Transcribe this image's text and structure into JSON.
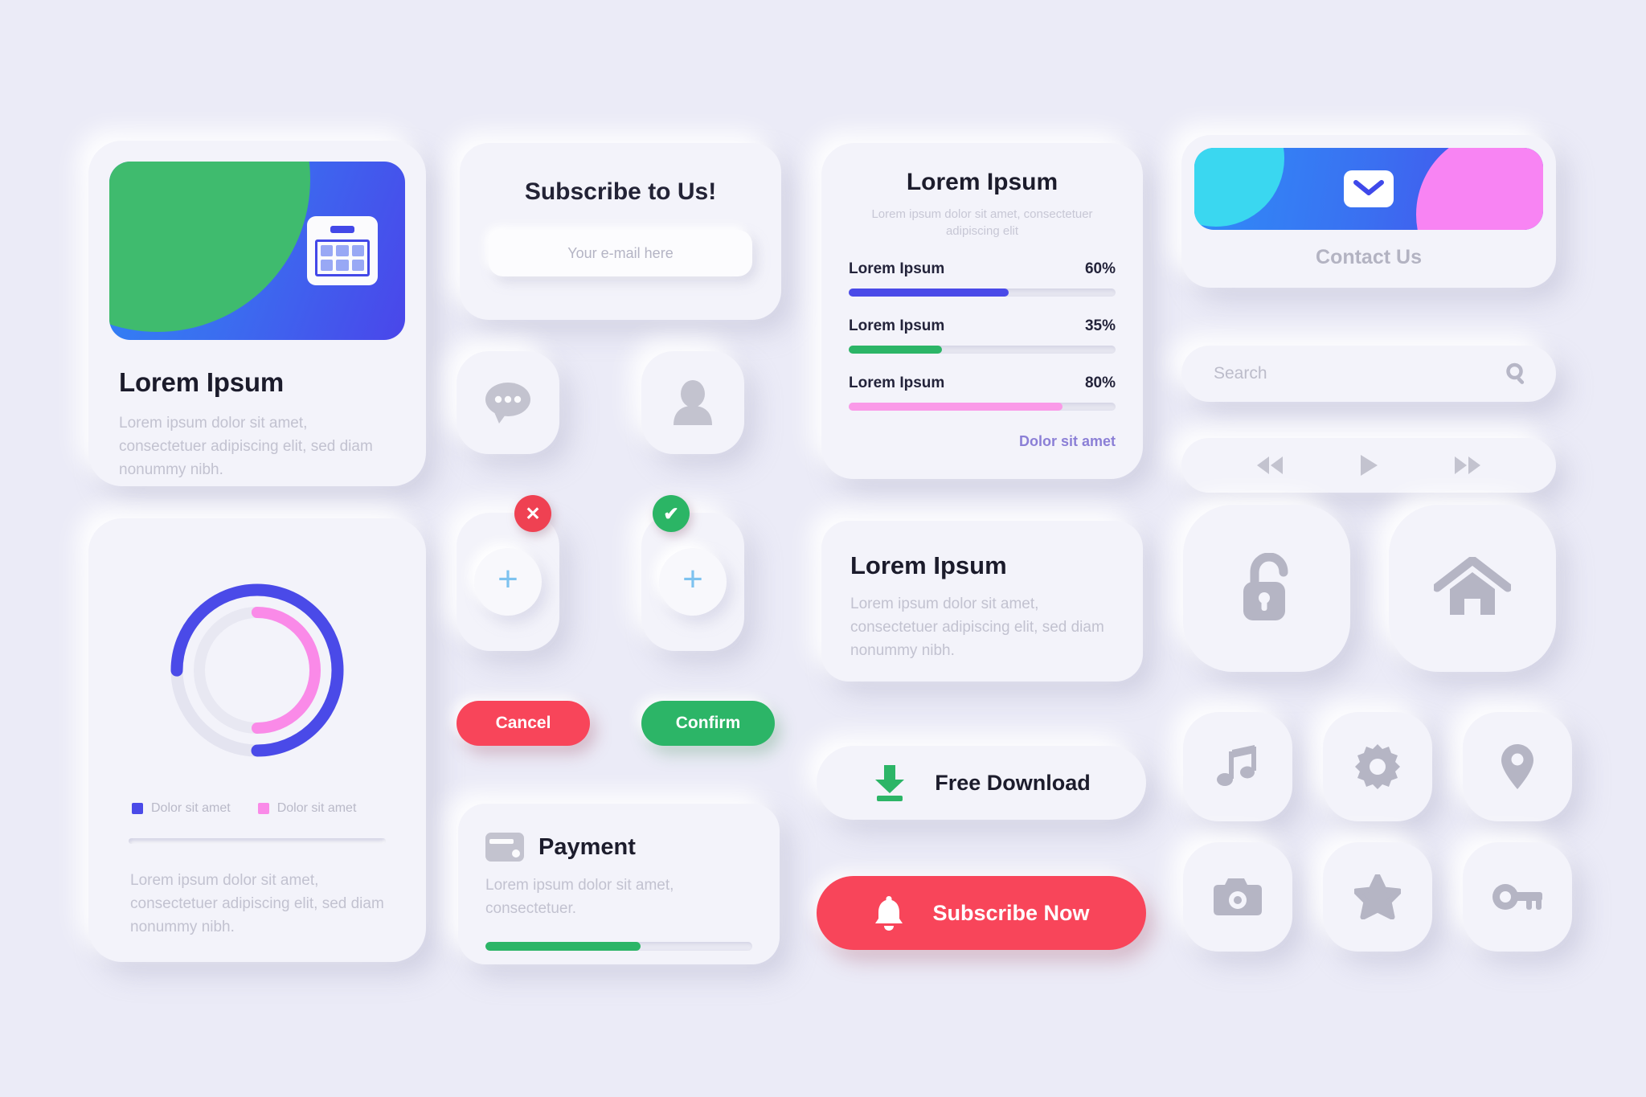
{
  "background_color": "#ebebf7",
  "media_card": {
    "title": "Lorem Ipsum",
    "description": "Lorem ipsum dolor sit amet, consectetuer adipiscing elit, sed diam nonummy nibh.",
    "banner_icon": "calendar-icon",
    "banner_colors": {
      "green": "#3fbb6e",
      "blue_start": "#2f86f6",
      "blue_end": "#4a46ea"
    }
  },
  "chart_card": {
    "description": "Lorem ipsum dolor sit amet, consectetuer adipiscing elit, sed diam nonummy nibh.",
    "legend": [
      {
        "label": "Dolor sit amet",
        "color": "#4a4ae8"
      },
      {
        "label": "Dolor sit amet",
        "color": "#fa8ae8"
      }
    ]
  },
  "chart_data": {
    "type": "pie",
    "title": "",
    "subtype": "donut-progress-rings",
    "legend_position": "bottom",
    "series": [
      {
        "name": "Dolor sit amet",
        "value": 75,
        "color": "#4a4ae8",
        "ring": "outer",
        "track_color": "#e4e4f0"
      },
      {
        "name": "Dolor sit amet",
        "value": 50,
        "color": "#fa8ae8",
        "ring": "inner",
        "track_color": "#e8e8f2"
      }
    ],
    "max": 100,
    "units": "%"
  },
  "subscribe_card": {
    "heading": "Subscribe to Us!",
    "email_placeholder": "Your e-mail here",
    "email_value": ""
  },
  "icon_buttons_middle": [
    {
      "name": "chat-icon",
      "label": "Chat"
    },
    {
      "name": "user-icon",
      "label": "User"
    }
  ],
  "plus_cards": [
    {
      "name": "add-cancel",
      "badge": "close-icon",
      "badge_color": "#ef4152",
      "plus": "+"
    },
    {
      "name": "add-confirm",
      "badge": "check-icon",
      "badge_color": "#2bb565",
      "plus": "+"
    }
  ],
  "action_buttons": {
    "cancel_label": "Cancel",
    "cancel_color": "#f8455a",
    "confirm_label": "Confirm",
    "confirm_color": "#2cb567"
  },
  "payment_card": {
    "title": "Payment",
    "description": "Lorem ipsum dolor sit amet, consectetuer.",
    "progress_percent": 58,
    "progress_color": "#2cb567",
    "icon": "credit-card-icon"
  },
  "progress_card": {
    "title": "Lorem Ipsum",
    "subtitle": "Lorem ipsum dolor sit amet, consectetuer adipiscing elit",
    "link_label": "Dolor sit amet",
    "link_color": "#8b7fd6"
  },
  "progress_chart_data": {
    "type": "bar",
    "orientation": "horizontal",
    "categories": [
      "Lorem Ipsum",
      "Lorem Ipsum",
      "Lorem Ipsum"
    ],
    "values": [
      60,
      35,
      80
    ],
    "value_labels": [
      "60%",
      "35%",
      "80%"
    ],
    "colors": [
      "#4a4ae8",
      "#2cb567",
      "#fa9ae8"
    ],
    "xlabel": "",
    "ylabel": "",
    "xlim": [
      0,
      100
    ],
    "grid": false
  },
  "info_card": {
    "title": "Lorem Ipsum",
    "description": "Lorem ipsum dolor sit amet, consectetuer adipiscing elit, sed diam nonummy nibh."
  },
  "download_button": {
    "label": "Free Download",
    "icon": "download-icon",
    "icon_color": "#2cb567"
  },
  "subscribe_now_button": {
    "label": "Subscribe Now",
    "icon": "bell-icon",
    "background": "#f8455a"
  },
  "contact_card": {
    "label": "Contact Us",
    "icon": "mail-icon",
    "banner_colors": {
      "cyan": "#3ad7f0",
      "blue": "#3a70f1",
      "pink": "#f884f3"
    }
  },
  "search_bar": {
    "placeholder": "Search",
    "value": "",
    "icon": "search-icon"
  },
  "media_player": {
    "controls": [
      {
        "name": "rewind-button",
        "icon": "rewind-icon"
      },
      {
        "name": "play-button",
        "icon": "play-icon"
      },
      {
        "name": "forward-button",
        "icon": "forward-icon"
      }
    ]
  },
  "icon_grid": [
    {
      "name": "lock-button",
      "icon": "unlock-icon",
      "label": "Lock"
    },
    {
      "name": "home-button",
      "icon": "home-icon",
      "label": "Home"
    },
    {
      "name": "music-button",
      "icon": "music-note-icon",
      "label": "Music"
    },
    {
      "name": "settings-button",
      "icon": "gear-icon",
      "label": "Settings"
    },
    {
      "name": "location-button",
      "icon": "location-pin-icon",
      "label": "Location"
    },
    {
      "name": "camera-button",
      "icon": "camera-icon",
      "label": "Camera"
    },
    {
      "name": "favorite-button",
      "icon": "star-icon",
      "label": "Favorite"
    },
    {
      "name": "key-button",
      "icon": "key-icon",
      "label": "Key"
    }
  ]
}
